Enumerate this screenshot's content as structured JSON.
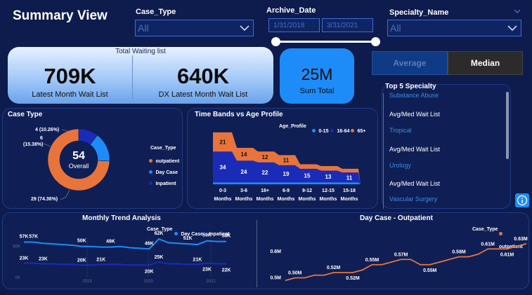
{
  "page": {
    "title": "Summary View"
  },
  "slicers": {
    "case_type": {
      "label": "Case_Type",
      "value": "All"
    },
    "archive_date": {
      "label": "Archive_Date",
      "start": "1/31/2018",
      "end": "3/31/2021"
    },
    "specialty": {
      "label": "Specialty_Name",
      "value": "All"
    }
  },
  "kpis": {
    "title": "Total Waiting list",
    "latest": {
      "value": "709K",
      "label": "Latest Month Wait List"
    },
    "dx_latest": {
      "value": "640K",
      "label": "DX Latest Month Wait List"
    },
    "sum_total": {
      "value": "25M",
      "label": "Sum Total"
    }
  },
  "toggle": {
    "average": "Average",
    "median": "Median"
  },
  "specialty_panel": {
    "title": "Top 5 Specialty",
    "items": [
      {
        "name": "Substance Abuse",
        "metric": "Avg/Med Wait List"
      },
      {
        "name": "Tropical",
        "metric": "Avg/Med Wait List"
      },
      {
        "name": "Urology",
        "metric": "Avg/Med Wait List"
      },
      {
        "name": "Vascular Surgery",
        "metric": ""
      }
    ],
    "info_icon": "info-icon"
  },
  "colors": {
    "outpatient": "#e8743b",
    "day_case": "#1d8cf8",
    "inpatient": "#1a2bb8",
    "age_0_15": "#1d8cf8",
    "age_16_64": "#1a2bb8",
    "age_65": "#e8743b"
  },
  "chart_data": [
    {
      "type": "pie",
      "title": "Case Type",
      "center_value": "54",
      "center_label": "Overall",
      "legend_title": "Case_Type",
      "series": [
        {
          "name": "outpatient",
          "value": 29,
          "label": "29 (74.36%)"
        },
        {
          "name": "Day Case",
          "value": 6,
          "label": "6\n(15.38%)"
        },
        {
          "name": "Inpatient",
          "value": 4,
          "label": "4 (10.26%)"
        }
      ]
    },
    {
      "type": "area",
      "title": "Time Bands vs Age Profile",
      "legend_title": "Age_Profile",
      "categories": [
        "0-3 Months",
        "3-6 Months",
        "18+ Months",
        "6-9 Months",
        "9-12 Months",
        "12-15 Months",
        "15-18 Months"
      ],
      "series": [
        {
          "name": "0-15",
          "values": [
            2,
            2,
            2,
            2,
            2,
            2,
            2
          ]
        },
        {
          "name": "16-64",
          "values": [
            34,
            24,
            22,
            19,
            15,
            13,
            11
          ]
        },
        {
          "name": "65+",
          "values": [
            21,
            14,
            12,
            11,
            5,
            5,
            4
          ]
        }
      ],
      "labels_16_64": [
        "34",
        "24",
        "22",
        "19",
        "15",
        "13",
        "11"
      ],
      "labels_65": [
        "21",
        "14",
        "12",
        "11",
        "",
        "",
        ""
      ]
    },
    {
      "type": "line",
      "title": "Monthly Trend Analysis",
      "legend_title": "Case_Type",
      "x_ticks": [
        "2019",
        "2020",
        "2021"
      ],
      "y_ticks": [
        "50K",
        "0K"
      ],
      "series": [
        {
          "name": "Day Case",
          "values": [
            57,
            57,
            55,
            54,
            53,
            52,
            50,
            50,
            49,
            49,
            50,
            48,
            47,
            46,
            62,
            56,
            55,
            54,
            53,
            59,
            58,
            58
          ]
        },
        {
          "name": "Inpatient",
          "values": [
            23,
            23,
            22,
            22,
            21,
            21,
            20,
            20,
            21,
            21,
            21,
            20,
            20,
            20,
            25,
            22,
            22,
            21,
            21,
            23,
            22,
            22
          ]
        }
      ],
      "point_labels": [
        {
          "text": "57K",
          "series": 0,
          "i": 0
        },
        {
          "text": "57K",
          "series": 0,
          "i": 1
        },
        {
          "text": "50K",
          "series": 0,
          "i": 6
        },
        {
          "text": "49K",
          "series": 0,
          "i": 9
        },
        {
          "text": "46K",
          "series": 0,
          "i": 13
        },
        {
          "text": "62K",
          "series": 0,
          "i": 14
        },
        {
          "text": "51K",
          "series": 0,
          "i": 17
        },
        {
          "text": "59K",
          "series": 0,
          "i": 19
        },
        {
          "text": "58K",
          "series": 0,
          "i": 21
        },
        {
          "text": "23K",
          "series": 1,
          "i": 0
        },
        {
          "text": "23K",
          "series": 1,
          "i": 2
        },
        {
          "text": "20K",
          "series": 1,
          "i": 6
        },
        {
          "text": "21K",
          "series": 1,
          "i": 8
        },
        {
          "text": "20K",
          "series": 1,
          "i": 13
        },
        {
          "text": "25K",
          "series": 1,
          "i": 14
        },
        {
          "text": "21K",
          "series": 1,
          "i": 18
        },
        {
          "text": "23K",
          "series": 1,
          "i": 19
        },
        {
          "text": "22K",
          "series": 1,
          "i": 21
        }
      ]
    },
    {
      "type": "line",
      "title": "Day Case - Outpatient",
      "legend_title": "Case_Type",
      "y_ticks": [
        "0.6M",
        "0.5M"
      ],
      "series": [
        {
          "name": "outpatient",
          "values": [
            0.49,
            0.5,
            0.5,
            0.51,
            0.51,
            0.52,
            0.52,
            0.52,
            0.53,
            0.55,
            0.55,
            0.56,
            0.57,
            0.57,
            0.55,
            0.55,
            0.56,
            0.57,
            0.58,
            0.58,
            0.59,
            0.61,
            0.61,
            0.61,
            0.62,
            0.63
          ]
        }
      ],
      "point_labels": [
        {
          "text": "0.50M",
          "i": 1
        },
        {
          "text": "0.52M",
          "i": 5
        },
        {
          "text": "0.52M",
          "i": 7
        },
        {
          "text": "0.55M",
          "i": 9
        },
        {
          "text": "0.57M",
          "i": 12
        },
        {
          "text": "0.55M",
          "i": 15
        },
        {
          "text": "0.58M",
          "i": 18
        },
        {
          "text": "0.61M",
          "i": 21
        },
        {
          "text": "0.61M",
          "i": 23
        },
        {
          "text": "0.63M",
          "i": 25
        }
      ]
    }
  ]
}
